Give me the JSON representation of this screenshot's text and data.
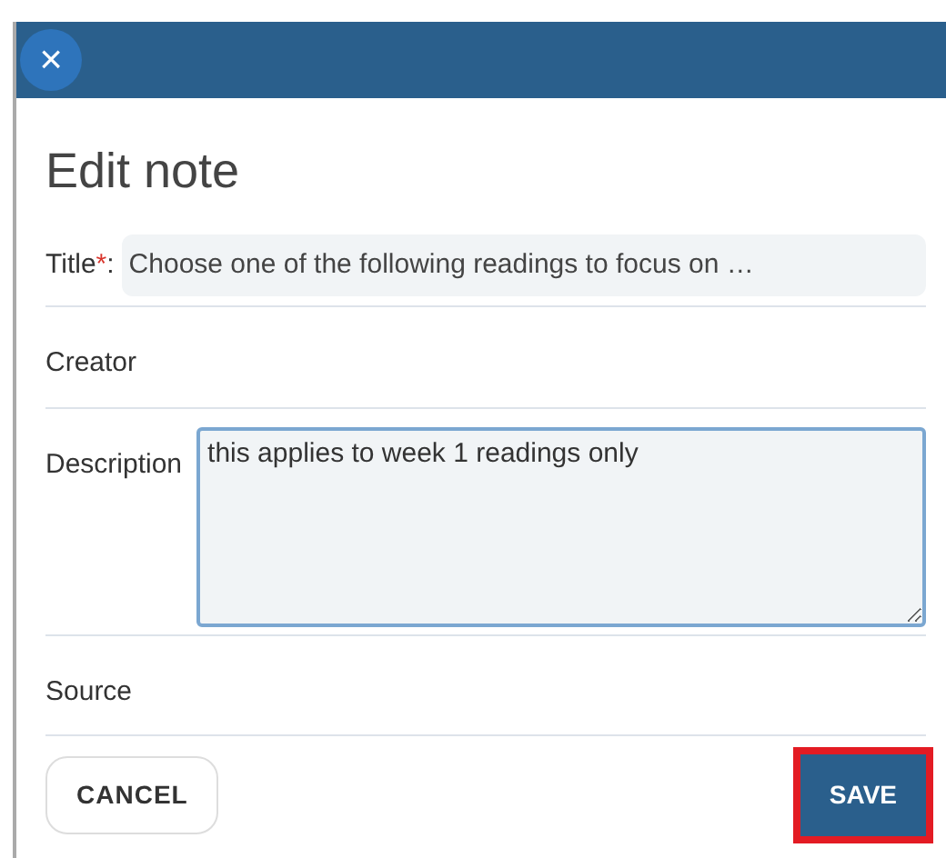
{
  "dialog": {
    "close_icon": "×",
    "title": "Edit note"
  },
  "fields": [
    {
      "kind": "input",
      "label": "Title",
      "required_mark": "*",
      "separator": ":",
      "value": "Choose one of the following readings to focus on …"
    },
    {
      "kind": "empty",
      "label": "Creator"
    },
    {
      "kind": "textarea",
      "label": "Description",
      "value": "this applies to week 1 readings only"
    },
    {
      "kind": "empty",
      "label": "Source"
    }
  ],
  "buttons": [
    {
      "label": "CANCEL",
      "kind": "secondary",
      "highlighted": false
    },
    {
      "label": "SAVE",
      "kind": "primary",
      "highlighted": true
    }
  ]
}
